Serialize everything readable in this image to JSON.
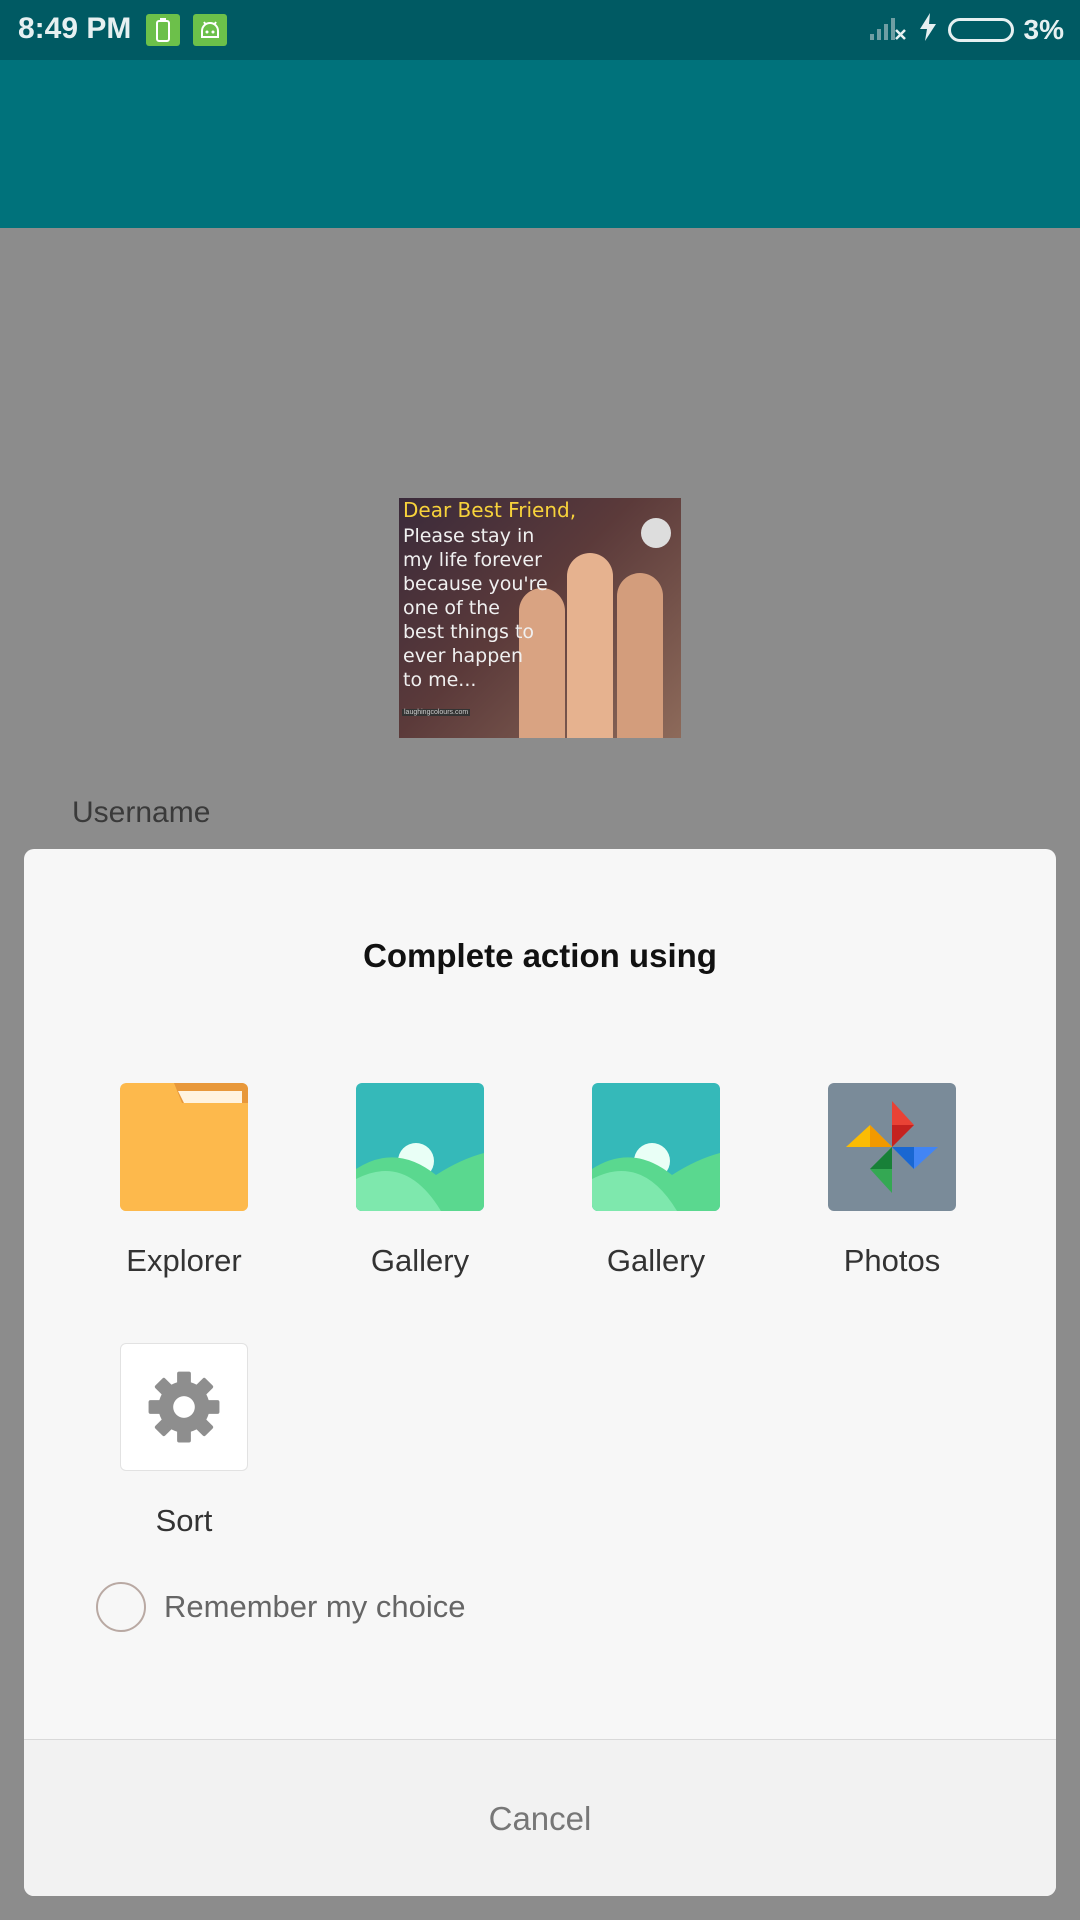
{
  "status_bar": {
    "time": "8:49 PM",
    "battery_percent": "3%",
    "icons": [
      "battery-saver-icon",
      "android-icon",
      "signal-off-icon",
      "charging-bolt-icon",
      "battery-icon"
    ]
  },
  "background": {
    "image_lines": [
      "Dear Best Friend,",
      "Please stay in",
      "my life forever",
      "because you're",
      "one of the",
      "best things to",
      "ever happen",
      "to me..."
    ],
    "image_credit": "laughingcolours.com",
    "username_label": "Username"
  },
  "dialog": {
    "title": "Complete action using",
    "apps": [
      {
        "label": "Explorer",
        "icon": "folder-icon"
      },
      {
        "label": "Gallery",
        "icon": "gallery-icon"
      },
      {
        "label": "Gallery",
        "icon": "gallery-icon"
      },
      {
        "label": "Photos",
        "icon": "photos-pinwheel-icon"
      },
      {
        "label": "Sort",
        "icon": "gear-icon"
      }
    ],
    "remember_label": "Remember my choice",
    "cancel_label": "Cancel"
  },
  "colors": {
    "status_bar": "#005a63",
    "toolbar": "#00727b",
    "dialog_bg": "#f7f7f7",
    "folder": "#fdb94c",
    "gallery_sky": "#35b9b9",
    "gallery_hill": "#5ad88f"
  }
}
